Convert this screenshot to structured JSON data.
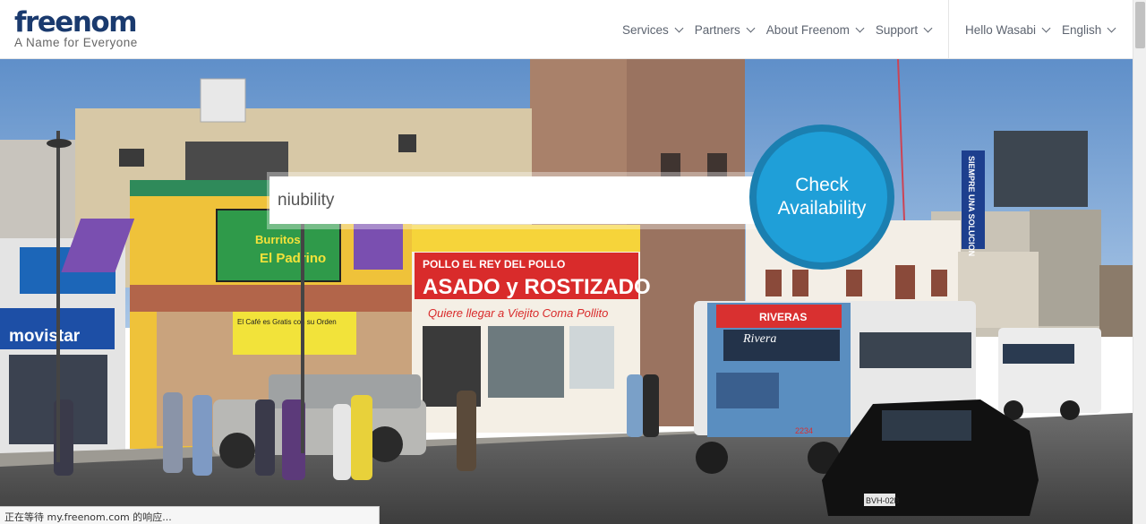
{
  "header": {
    "logo_text": "freenom",
    "tagline": "A Name for Everyone",
    "nav": [
      {
        "label": "Services"
      },
      {
        "label": "Partners"
      },
      {
        "label": "About Freenom"
      },
      {
        "label": "Support"
      }
    ],
    "user_nav": [
      {
        "label": "Hello Wasabi"
      },
      {
        "label": "English"
      }
    ]
  },
  "search": {
    "value": "niubility",
    "button_line1": "Check",
    "button_line2": "Availability"
  },
  "status_bar": {
    "text": "正在等待 my.freenom.com 的响应..."
  },
  "hero_signs": {
    "burritos_line1": "Burritos",
    "burritos_line2": "El Padrino",
    "movistar": "movistar",
    "pollo_top": "POLLO  EL REY DEL POLLO",
    "asado": "ASADO y ROSTIZADO",
    "quiere": "Quiere llegar a Viejito Coma Pollito",
    "cafe": "El Café es Gratis con su Orden",
    "riveras": "RIVERAS",
    "rivera_banner": "Rivera",
    "solucion": "SIEMPRE UNA SOLUCION",
    "plate": "BVH-02B",
    "bus_num": "2234"
  },
  "colors": {
    "brand_dark": "#1a3a6e",
    "brand_blue": "#1e9ad6",
    "button_blue": "#1f9fd8",
    "nav_text": "#5d6470"
  }
}
